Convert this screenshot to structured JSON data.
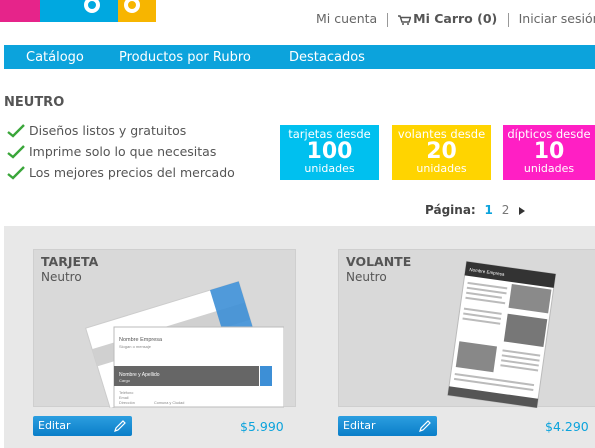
{
  "top_links": {
    "account": "Mi cuenta",
    "cart": "Mi Carro (0)",
    "login": "Iniciar sesión"
  },
  "nav": {
    "items": [
      "Catálogo",
      "Productos por Rubro",
      "Destacados"
    ]
  },
  "section_title": "NEUTRO",
  "benefits": [
    "Diseños listos y gratuitos",
    "Imprime solo lo que necesitas",
    "Los mejores precios del mercado"
  ],
  "promos": [
    {
      "label": "tarjetas desde",
      "number": "100",
      "unit": "unidades",
      "color": "#00c0ef"
    },
    {
      "label": "volantes desde",
      "number": "20",
      "unit": "unidades",
      "color": "#ffd400"
    },
    {
      "label": "dípticos desde",
      "number": "10",
      "unit": "unidades",
      "color": "#ff1fc4"
    }
  ],
  "pager": {
    "label": "Página:",
    "pages": [
      "1",
      "2"
    ]
  },
  "products": [
    {
      "title": "TARJETA",
      "subtitle": "Neutro",
      "edit_label": "Editar",
      "price": "$5.990",
      "preview": {
        "company": "Nombre Empresa",
        "slogan": "Slogan o mensaje",
        "name": "Nombre y Apellido",
        "role": "Cargo",
        "contact": [
          "Teléfono",
          "Email",
          "Dirección",
          "Comuna y Ciudad"
        ]
      }
    },
    {
      "title": "VOLANTE",
      "subtitle": "Neutro",
      "edit_label": "Editar",
      "price": "$4.290",
      "preview": {
        "company": "Nombre Empresa"
      }
    }
  ],
  "colors": {
    "nav": "#0ca3dc",
    "accent_gray": "#555555",
    "accent_blue": "#3d8fd6"
  }
}
